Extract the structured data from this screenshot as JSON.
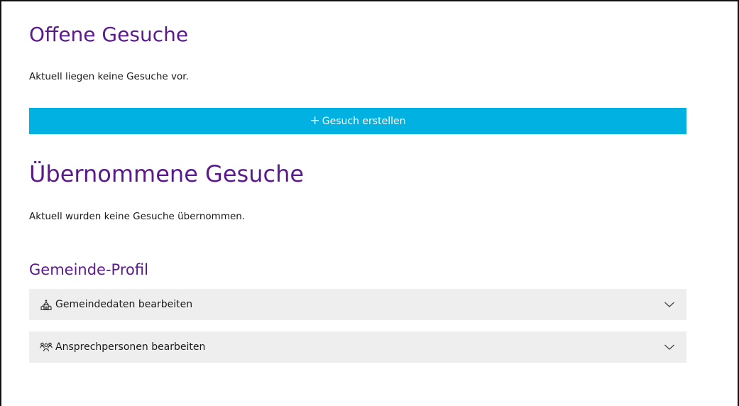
{
  "offene_gesuche": {
    "title": "Offene Gesuche",
    "empty_text": "Aktuell liegen keine Gesuche vor.",
    "create_button": {
      "icon": "+",
      "label": "Gesuch erstellen",
      "color": "#00b1e2"
    }
  },
  "uebernommene_gesuche": {
    "title": "Übernommene Gesuche",
    "empty_text": "Aktuell wurden keine Gesuche übernommen."
  },
  "gemeinde_profil": {
    "title": "Gemeinde-Profil",
    "items": [
      {
        "icon": "church-icon",
        "label": "Gemeindedaten bearbeiten"
      },
      {
        "icon": "people-icon",
        "label": "Ansprechpersonen bearbeiten"
      }
    ]
  },
  "colors": {
    "heading": "#5b1a8b",
    "button": "#00b1e2",
    "accordion_bg": "#eeeeee"
  }
}
